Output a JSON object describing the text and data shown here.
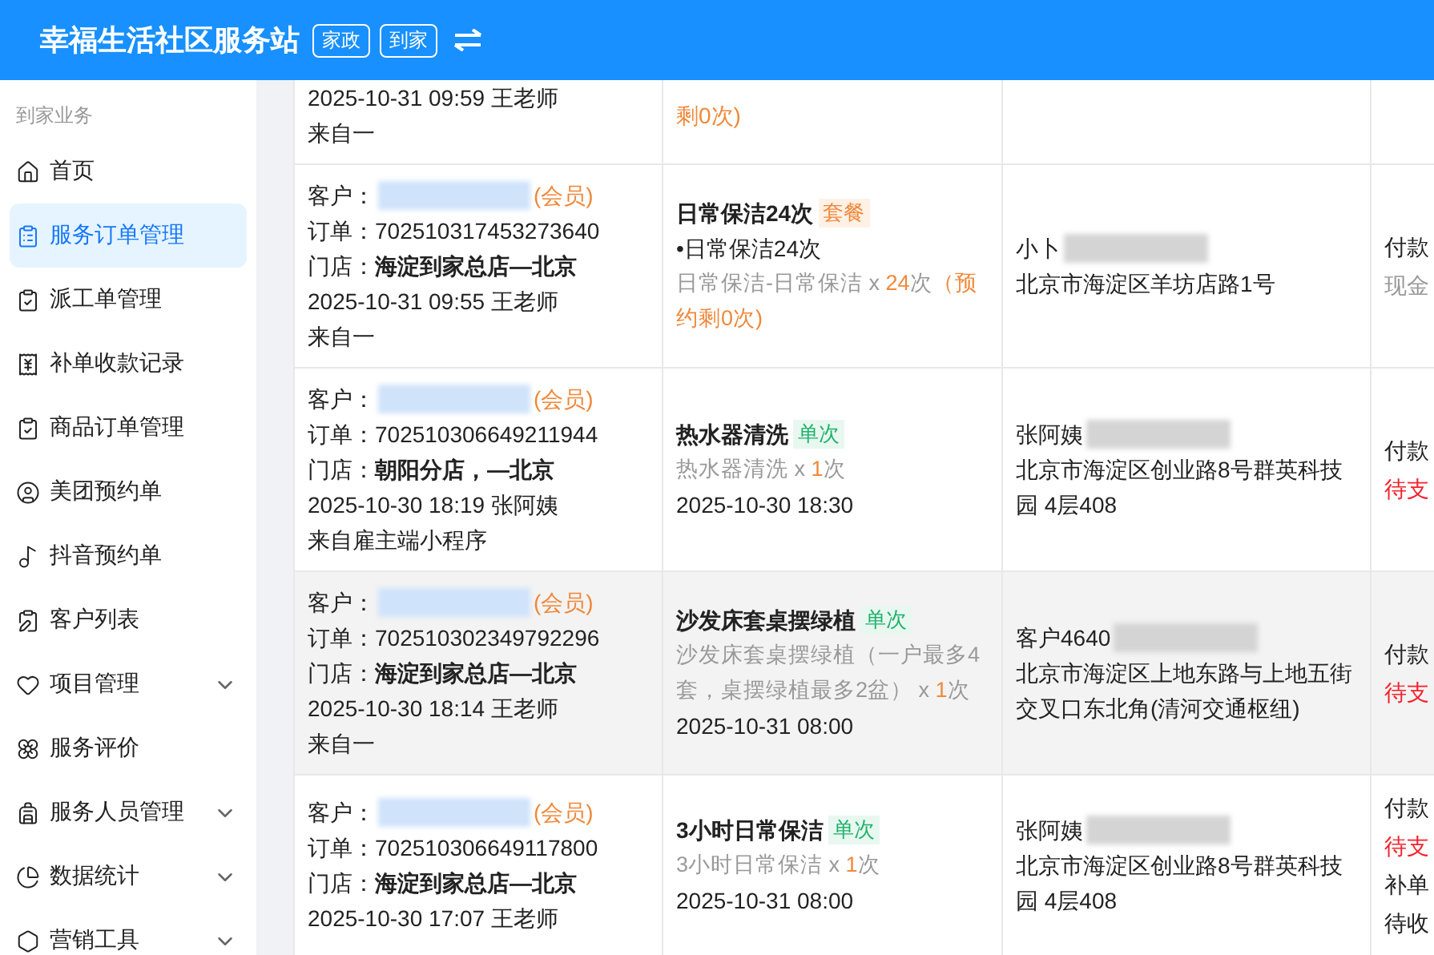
{
  "header": {
    "title": "幸福生活社区服务站",
    "tags": [
      "家政",
      "到家"
    ]
  },
  "sidebar": {
    "section": "到家业务",
    "items": [
      {
        "label": "首页",
        "selected": false,
        "expandable": false
      },
      {
        "label": "服务订单管理",
        "selected": true,
        "expandable": false
      },
      {
        "label": "派工单管理",
        "selected": false,
        "expandable": false
      },
      {
        "label": "补单收款记录",
        "selected": false,
        "expandable": false
      },
      {
        "label": "商品订单管理",
        "selected": false,
        "expandable": false
      },
      {
        "label": "美团预约单",
        "selected": false,
        "expandable": false
      },
      {
        "label": "抖音预约单",
        "selected": false,
        "expandable": false
      },
      {
        "label": "客户列表",
        "selected": false,
        "expandable": false
      },
      {
        "label": "项目管理",
        "selected": false,
        "expandable": true
      },
      {
        "label": "服务评价",
        "selected": false,
        "expandable": false
      },
      {
        "label": "服务人员管理",
        "selected": false,
        "expandable": true
      },
      {
        "label": "数据统计",
        "selected": false,
        "expandable": true
      },
      {
        "label": "营销工具",
        "selected": false,
        "expandable": true
      }
    ]
  },
  "orders": [
    {
      "highlighted": false,
      "created": "2025-10-31 09:59 王老师",
      "source": "来自一",
      "service": {
        "remain": "剩0次)"
      }
    },
    {
      "highlighted": false,
      "customer": {
        "label": "客户：",
        "member": "(会员)"
      },
      "order": {
        "label": "订单：",
        "value": "702510317453273640"
      },
      "store": {
        "label": "门店：",
        "value": "海淀到家总店—北京"
      },
      "created": "2025-10-31 09:55 王老师",
      "source": "来自一",
      "service": {
        "title": "日常保洁24次",
        "tags": [
          {
            "label": "套餐",
            "kind": "package"
          }
        ],
        "bullet": "•日常保洁24次",
        "item": "日常保洁-日常保洁 x ",
        "count": "24",
        "unit": "次",
        "remain": "（预约剩0次)"
      },
      "contact": {
        "name": "小卜",
        "address": "北京市海淀区羊坊店路1号"
      },
      "payment": [
        {
          "kind": "label",
          "text": "付款"
        },
        {
          "kind": "muted",
          "text": "现金"
        }
      ]
    },
    {
      "highlighted": false,
      "customer": {
        "label": "客户：",
        "member": "(会员)"
      },
      "order": {
        "label": "订单：",
        "value": "702510306649211944"
      },
      "store": {
        "label": "门店：",
        "value": "朝阳分店，—北京"
      },
      "created": "2025-10-30 18:19 张阿姨",
      "source": "来自雇主端小程序",
      "service": {
        "title": "热水器清洗",
        "tags": [
          {
            "label": "单次",
            "kind": "single"
          }
        ],
        "item": "热水器清洗 x ",
        "count": "1",
        "unit": "次",
        "time": "2025-10-30 18:30"
      },
      "contact": {
        "name": "张阿姨",
        "address": "北京市海淀区创业路8号群英科技园 4层408"
      },
      "payment": [
        {
          "kind": "label",
          "text": "付款"
        },
        {
          "kind": "alert",
          "text": "待支"
        }
      ]
    },
    {
      "highlighted": true,
      "customer": {
        "label": "客户：",
        "member": "(会员)"
      },
      "order": {
        "label": "订单：",
        "value": "702510302349792296"
      },
      "store": {
        "label": "门店：",
        "value": "海淀到家总店—北京"
      },
      "created": "2025-10-30 18:14 王老师",
      "source": "来自一",
      "service": {
        "title": "沙发床套桌摆绿植",
        "tags": [
          {
            "label": "单次",
            "kind": "single"
          }
        ],
        "item": "沙发床套桌摆绿植（一户最多4套，桌摆绿植最多2盆） x ",
        "count": "1",
        "unit": "次",
        "time": "2025-10-31 08:00"
      },
      "contact": {
        "name": "客户4640",
        "address": "北京市海淀区上地东路与上地五街交叉口东北角(清河交通枢纽)"
      },
      "payment": [
        {
          "kind": "label",
          "text": "付款"
        },
        {
          "kind": "alert",
          "text": "待支"
        }
      ]
    },
    {
      "highlighted": false,
      "customer": {
        "label": "客户：",
        "member": "(会员)"
      },
      "order": {
        "label": "订单：",
        "value": "702510306649117800"
      },
      "store": {
        "label": "门店：",
        "value": "海淀到家总店—北京"
      },
      "created": "2025-10-30 17:07 王老师",
      "service": {
        "title": "3小时日常保洁",
        "tags": [
          {
            "label": "单次",
            "kind": "single"
          }
        ],
        "item": "3小时日常保洁 x ",
        "count": "1",
        "unit": "次",
        "time": "2025-10-31 08:00"
      },
      "contact": {
        "name": "张阿姨",
        "address": "北京市海淀区创业路8号群英科技园 4层408"
      },
      "payment": [
        {
          "kind": "label",
          "text": "付款"
        },
        {
          "kind": "alert",
          "text": "待支"
        },
        {
          "kind": "label",
          "text": "补单"
        },
        {
          "kind": "plain",
          "text": "待收"
        }
      ]
    }
  ]
}
